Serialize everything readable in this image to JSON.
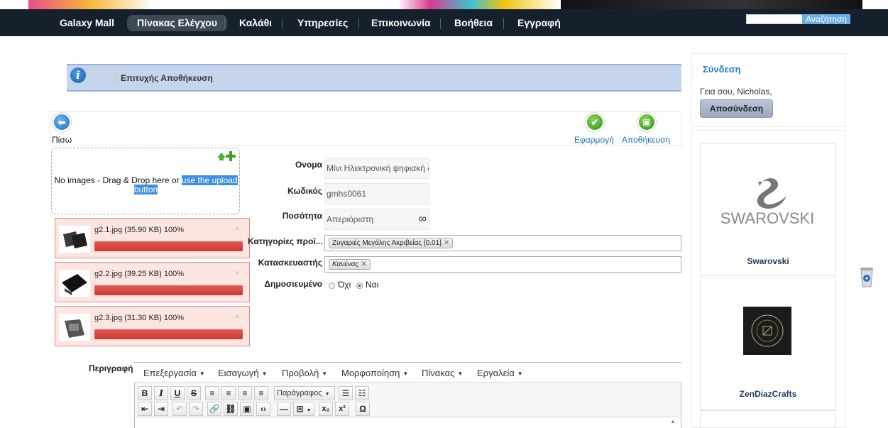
{
  "nav": {
    "items": [
      {
        "label": "Galaxy Mall"
      },
      {
        "label": "Πίνακας Ελέγχου"
      },
      {
        "label": "Καλάθι"
      },
      {
        "label": "Υπηρεσίες"
      },
      {
        "label": "Επικοινωνία"
      },
      {
        "label": "Βοήθεια"
      },
      {
        "label": "Εγγραφή"
      }
    ],
    "active_index": 1,
    "search_button": "Αναζήτηση",
    "search_value": ""
  },
  "message": {
    "text": "Επιτυχής Αποθήκευση"
  },
  "toolbar": {
    "back": "Πίσω",
    "apply": "Εφαρμογή",
    "save": "Αποθήκευση"
  },
  "uploader": {
    "text_plain": "No images - Drag & Drop here or ",
    "text_link": "use the upload button",
    "files": [
      {
        "name": "g2.1.jpg (35.90 KB) 100%",
        "progress": 1.0
      },
      {
        "name": "g2.2.jpg (39.25 KB) 100%",
        "progress": 1.0
      },
      {
        "name": "g2.3.jpg (31.30 KB) 100%",
        "progress": 1.0
      }
    ]
  },
  "form": {
    "name_label": "Ονομα",
    "name_value": "Μίνι Ηλεκτρονική ψηφιακή ζ",
    "code_label": "Κωδικός",
    "code_value": "gmhs0061",
    "qty_label": "Ποσότητα",
    "qty_value": "Απεριόριστη",
    "qty_symbol": "∞",
    "categories_label": "Κατηγορίες προϊ...",
    "categories_tag": "Ζυγαριές Μεγάλης Ακριβείας [0.01]",
    "manufacturer_label": "Κατασκευαστής",
    "manufacturer_tag": "Κανένας",
    "published_label": "Δημοσιευμένο",
    "published_no": "Όχι",
    "published_yes": "Ναι",
    "published_value": "Ναι",
    "description_label": "Περιγραφή"
  },
  "editor": {
    "menus": [
      "Επεξεργασία",
      "Εισαγωγή",
      "Προβολή",
      "Μορφοποίηση",
      "Πίνακας",
      "Εργαλεία"
    ],
    "format_select": "Παράγραφος"
  },
  "sidebar": {
    "login_title": "Σύνδεση",
    "greeting": "Γεια σου, Nicholas,",
    "logout": "Αποσύνδεση",
    "brands": [
      {
        "name": "Swarovski",
        "logo_text": "SWAROVSKI"
      },
      {
        "name": "ZenDiazCrafts"
      }
    ]
  },
  "colors": {
    "nav_bg": "#16202c",
    "accent_blue": "#1b73b8",
    "message_bg": "#c5d5eb",
    "upload_error_bg": "#fde5e1",
    "progress_red": "#d6463f"
  }
}
